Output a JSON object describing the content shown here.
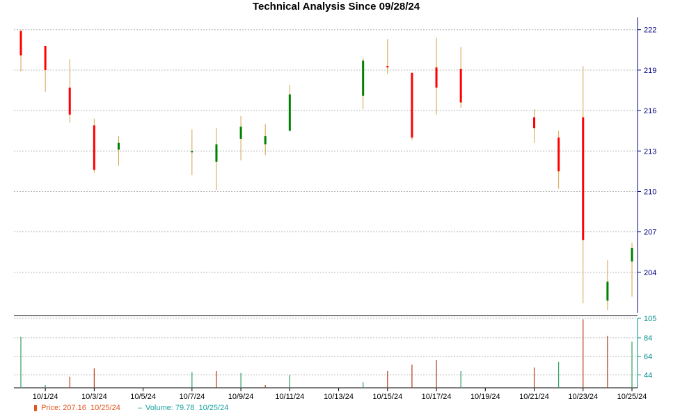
{
  "title": "Technical Analysis Since 09/28/24",
  "legend": {
    "price_label": "Price: 207.16",
    "price_date": "10/25/24",
    "volume_label": "Volume: 79.78",
    "volume_date": "10/25/24"
  },
  "colors": {
    "up": "#008000",
    "down": "#ff0000",
    "wick": "#d4a04a",
    "grid": "#b4b4b4",
    "price_axis": "#000080",
    "volume_axis": "#008b8b",
    "vol_up": "#2e9e5e",
    "vol_down": "#b33a1a"
  },
  "chart_data": [
    {
      "type": "candlestick",
      "title": "Technical Analysis Since 09/28/24",
      "ylim": [
        201,
        222.5
      ],
      "y_ticks": [
        204,
        207,
        210,
        213,
        216,
        219,
        222
      ],
      "x_domain": [
        "9/30/24",
        "10/25/24"
      ],
      "x_tick_labels": [
        "10/1/24",
        "10/3/24",
        "10/5/24",
        "10/7/24",
        "10/9/24",
        "10/11/24",
        "10/13/24",
        "10/15/24",
        "10/17/24",
        "10/19/24",
        "10/21/24",
        "10/23/24",
        "10/25/24"
      ],
      "grid": true,
      "series": [
        {
          "date": "9/30/24",
          "open": 221.9,
          "high": 222.0,
          "low": 218.9,
          "close": 220.1
        },
        {
          "date": "10/1/24",
          "open": 220.8,
          "high": 220.8,
          "low": 217.4,
          "close": 219.0
        },
        {
          "date": "10/2/24",
          "open": 217.7,
          "high": 219.8,
          "low": 215.1,
          "close": 215.7
        },
        {
          "date": "10/3/24",
          "open": 214.9,
          "high": 215.4,
          "low": 211.4,
          "close": 211.6
        },
        {
          "date": "10/4/24",
          "open": 213.1,
          "high": 214.1,
          "low": 211.9,
          "close": 213.6
        },
        {
          "date": "10/7/24",
          "open": 212.9,
          "high": 214.6,
          "low": 211.2,
          "close": 213.0
        },
        {
          "date": "10/8/24",
          "open": 212.2,
          "high": 214.7,
          "low": 210.1,
          "close": 213.5
        },
        {
          "date": "10/9/24",
          "open": 213.9,
          "high": 215.6,
          "low": 212.3,
          "close": 214.8
        },
        {
          "date": "10/10/24",
          "open": 213.5,
          "high": 215.0,
          "low": 212.7,
          "close": 214.1
        },
        {
          "date": "10/11/24",
          "open": 214.5,
          "high": 217.9,
          "low": 214.5,
          "close": 217.2
        },
        {
          "date": "10/14/24",
          "open": 217.1,
          "high": 219.9,
          "low": 216.1,
          "close": 219.7
        },
        {
          "date": "10/15/24",
          "open": 219.3,
          "high": 221.3,
          "low": 218.7,
          "close": 219.2
        },
        {
          "date": "10/16/24",
          "open": 218.8,
          "high": 218.8,
          "low": 213.8,
          "close": 214.0
        },
        {
          "date": "10/17/24",
          "open": 219.2,
          "high": 221.4,
          "low": 215.7,
          "close": 217.7
        },
        {
          "date": "10/18/24",
          "open": 219.1,
          "high": 220.7,
          "low": 216.2,
          "close": 216.6
        },
        {
          "date": "10/21/24",
          "open": 215.5,
          "high": 216.1,
          "low": 213.6,
          "close": 214.7
        },
        {
          "date": "10/22/24",
          "open": 214.0,
          "high": 214.5,
          "low": 210.2,
          "close": 211.5
        },
        {
          "date": "10/23/24",
          "open": 215.5,
          "high": 219.3,
          "low": 201.7,
          "close": 206.4
        },
        {
          "date": "10/24/24",
          "open": 201.9,
          "high": 204.9,
          "low": 201.2,
          "close": 203.3
        },
        {
          "date": "10/25/24",
          "open": 204.8,
          "high": 206.2,
          "low": 202.2,
          "close": 205.8
        }
      ]
    },
    {
      "type": "bar",
      "title": "Volume",
      "ylim": [
        30,
        105
      ],
      "y_ticks": [
        44,
        64,
        84,
        105
      ],
      "grid": true,
      "series": [
        {
          "date": "9/30/24",
          "value": 85,
          "dir": "up"
        },
        {
          "date": "10/1/24",
          "value": 33,
          "dir": "up"
        },
        {
          "date": "10/2/24",
          "value": 42,
          "dir": "down"
        },
        {
          "date": "10/3/24",
          "value": 51,
          "dir": "down"
        },
        {
          "date": "10/4/24",
          "value": 30,
          "dir": "up"
        },
        {
          "date": "10/7/24",
          "value": 47,
          "dir": "up"
        },
        {
          "date": "10/8/24",
          "value": 48,
          "dir": "down"
        },
        {
          "date": "10/9/24",
          "value": 46,
          "dir": "up"
        },
        {
          "date": "10/10/24",
          "value": 33,
          "dir": "down"
        },
        {
          "date": "10/11/24",
          "value": 44,
          "dir": "up"
        },
        {
          "date": "10/14/24",
          "value": 36,
          "dir": "up"
        },
        {
          "date": "10/15/24",
          "value": 48,
          "dir": "down"
        },
        {
          "date": "10/16/24",
          "value": 55,
          "dir": "down"
        },
        {
          "date": "10/17/24",
          "value": 60,
          "dir": "down"
        },
        {
          "date": "10/18/24",
          "value": 48,
          "dir": "up"
        },
        {
          "date": "10/21/24",
          "value": 52,
          "dir": "down"
        },
        {
          "date": "10/22/24",
          "value": 58,
          "dir": "up"
        },
        {
          "date": "10/23/24",
          "value": 104,
          "dir": "down"
        },
        {
          "date": "10/24/24",
          "value": 86,
          "dir": "down"
        },
        {
          "date": "10/25/24",
          "value": 79.78,
          "dir": "up"
        }
      ]
    }
  ]
}
